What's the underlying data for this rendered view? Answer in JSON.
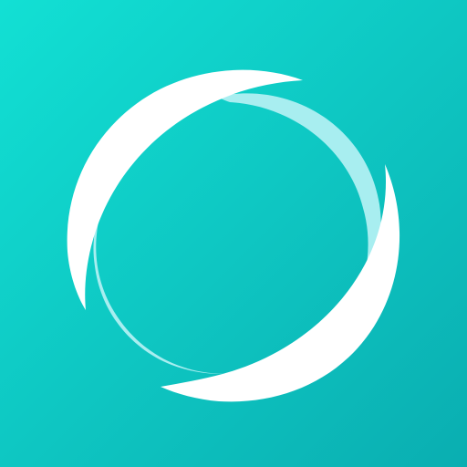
{
  "icon": {
    "name": "swirl-ring-icon",
    "colors": {
      "background_top_left": "#12e0d4",
      "background_bottom_right": "#0aaeb1",
      "primary_stroke": "#ffffff",
      "secondary_stroke": "#a8eef0"
    }
  }
}
